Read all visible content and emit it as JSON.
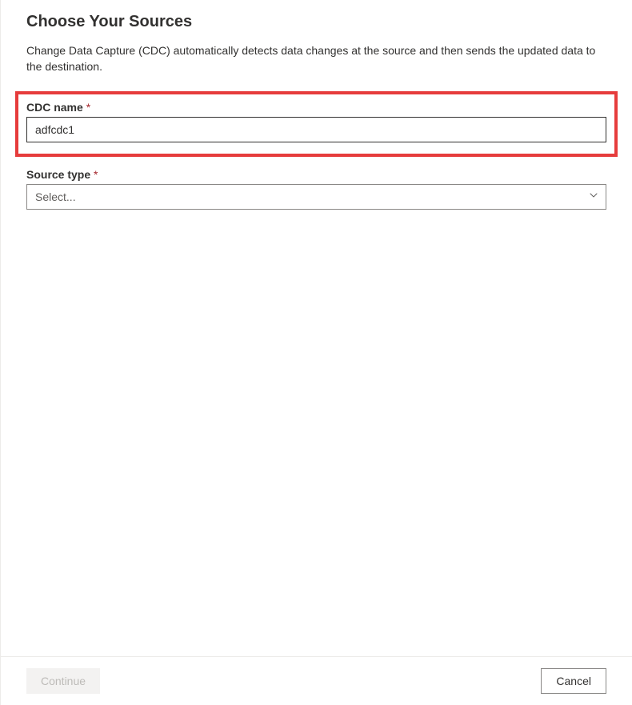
{
  "header": {
    "title": "Choose Your Sources",
    "description": "Change Data Capture (CDC) automatically detects data changes at the source and then sends the updated data to the destination."
  },
  "form": {
    "cdc_name": {
      "label": "CDC name",
      "required_marker": "*",
      "value": "adfcdc1"
    },
    "source_type": {
      "label": "Source type",
      "required_marker": "*",
      "placeholder": "Select..."
    }
  },
  "footer": {
    "continue_label": "Continue",
    "cancel_label": "Cancel"
  }
}
